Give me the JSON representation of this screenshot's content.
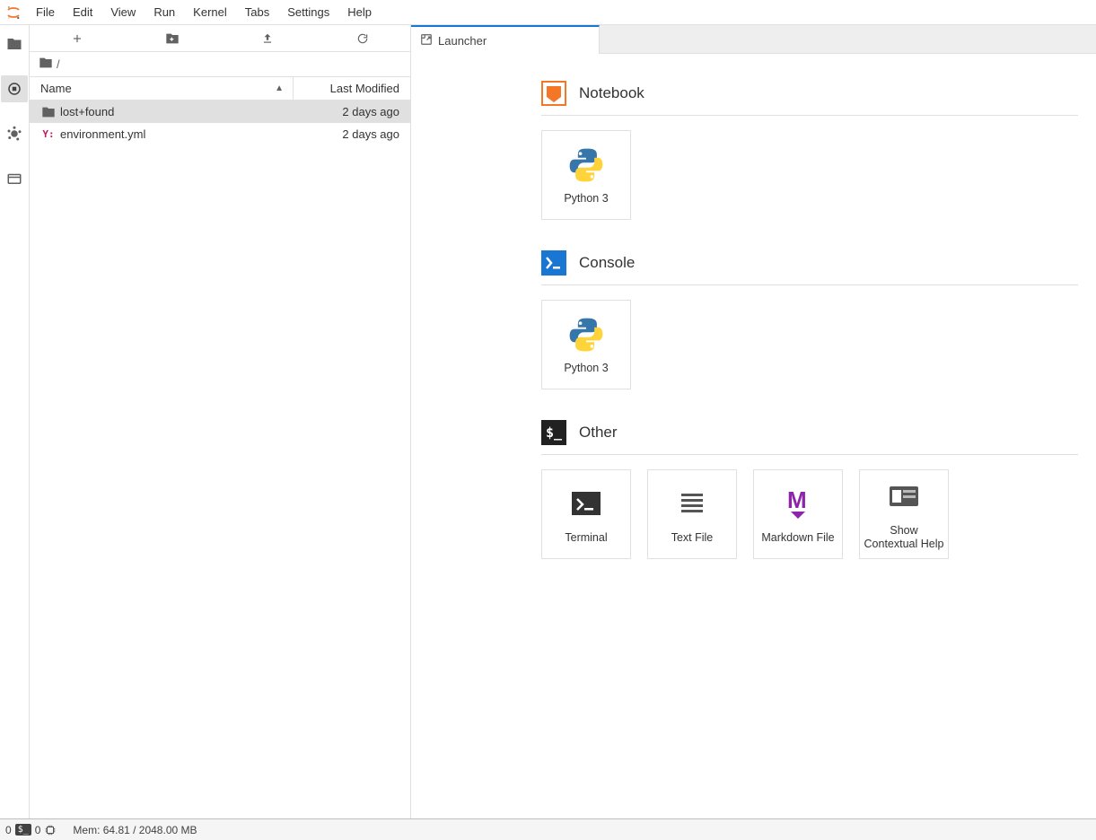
{
  "menu": [
    "File",
    "Edit",
    "View",
    "Run",
    "Kernel",
    "Tabs",
    "Settings",
    "Help"
  ],
  "breadcrumb_path": "/",
  "file_header": {
    "name": "Name",
    "modified": "Last Modified"
  },
  "files": [
    {
      "icon": "folder",
      "name": "lost+found",
      "modified": "2 days ago",
      "selected": true
    },
    {
      "icon": "yaml",
      "name": "environment.yml",
      "modified": "2 days ago",
      "selected": false
    }
  ],
  "tab": {
    "label": "Launcher"
  },
  "launcher": {
    "sections": [
      {
        "id": "notebook",
        "title": "Notebook",
        "cards": [
          {
            "icon": "python",
            "label": "Python 3"
          }
        ]
      },
      {
        "id": "console",
        "title": "Console",
        "cards": [
          {
            "icon": "python",
            "label": "Python 3"
          }
        ]
      },
      {
        "id": "other",
        "title": "Other",
        "cards": [
          {
            "icon": "terminal",
            "label": "Terminal"
          },
          {
            "icon": "textfile",
            "label": "Text File"
          },
          {
            "icon": "markdown",
            "label": "Markdown File"
          },
          {
            "icon": "help",
            "label": "Show Contextual Help"
          }
        ]
      }
    ]
  },
  "status": {
    "left_count1": "0",
    "left_count2": "0",
    "memory": "Mem: 64.81 / 2048.00 MB"
  }
}
